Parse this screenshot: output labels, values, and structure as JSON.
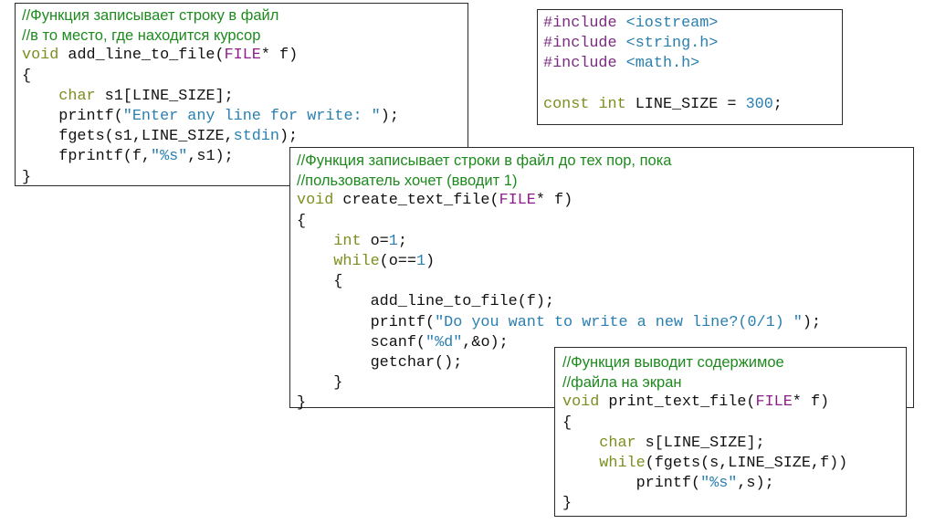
{
  "box_add_line": {
    "lines": [
      [
        {
          "t": "//Функция записывает строку в файл",
          "c": "comment"
        }
      ],
      [
        {
          "t": "//в то место, где находится курсор",
          "c": "comment"
        }
      ],
      [
        {
          "t": "void",
          "c": "kw"
        },
        {
          "t": " add_line_to_file(",
          "c": "plain"
        },
        {
          "t": "FILE",
          "c": "type"
        },
        {
          "t": "* f)",
          "c": "plain"
        }
      ],
      [
        {
          "t": "{",
          "c": "plain"
        }
      ],
      [
        {
          "t": "    ",
          "c": "plain"
        },
        {
          "t": "char",
          "c": "kw"
        },
        {
          "t": " s1[LINE_SIZE];",
          "c": "plain"
        }
      ],
      [
        {
          "t": "    printf(",
          "c": "plain"
        },
        {
          "t": "\"Enter any line for write: \"",
          "c": "str"
        },
        {
          "t": ");",
          "c": "plain"
        }
      ],
      [
        {
          "t": "    fgets(s1,LINE_SIZE,",
          "c": "plain"
        },
        {
          "t": "stdin",
          "c": "str"
        },
        {
          "t": ");",
          "c": "plain"
        }
      ],
      [
        {
          "t": "    fprintf(f,",
          "c": "plain"
        },
        {
          "t": "\"%s\"",
          "c": "str"
        },
        {
          "t": ",s1);",
          "c": "plain"
        }
      ],
      [
        {
          "t": "}",
          "c": "plain"
        }
      ]
    ]
  },
  "box_includes": {
    "lines": [
      [
        {
          "t": "#include",
          "c": "inc"
        },
        {
          "t": " ",
          "c": "plain"
        },
        {
          "t": "<iostream>",
          "c": "hdr"
        }
      ],
      [
        {
          "t": "#include",
          "c": "inc"
        },
        {
          "t": " ",
          "c": "plain"
        },
        {
          "t": "<string.h>",
          "c": "hdr"
        }
      ],
      [
        {
          "t": "#include",
          "c": "inc"
        },
        {
          "t": " ",
          "c": "plain"
        },
        {
          "t": "<math.h>",
          "c": "hdr"
        }
      ],
      [
        {
          "t": "",
          "c": "plain"
        }
      ],
      [
        {
          "t": "const",
          "c": "kw"
        },
        {
          "t": " ",
          "c": "plain"
        },
        {
          "t": "int",
          "c": "kw"
        },
        {
          "t": " LINE_SIZE = ",
          "c": "plain"
        },
        {
          "t": "300",
          "c": "num"
        },
        {
          "t": ";",
          "c": "plain"
        }
      ]
    ]
  },
  "box_create": {
    "lines": [
      [
        {
          "t": "//Функция записывает строки в файл до тех пор, пока",
          "c": "comment"
        }
      ],
      [
        {
          "t": "//пользователь хочет (вводит 1)",
          "c": "comment"
        }
      ],
      [
        {
          "t": "void",
          "c": "kw"
        },
        {
          "t": " create_text_file(",
          "c": "plain"
        },
        {
          "t": "FILE",
          "c": "type"
        },
        {
          "t": "* f)",
          "c": "plain"
        }
      ],
      [
        {
          "t": "{",
          "c": "plain"
        }
      ],
      [
        {
          "t": "    ",
          "c": "plain"
        },
        {
          "t": "int",
          "c": "kw"
        },
        {
          "t": " o=",
          "c": "plain"
        },
        {
          "t": "1",
          "c": "num"
        },
        {
          "t": ";",
          "c": "plain"
        }
      ],
      [
        {
          "t": "    ",
          "c": "plain"
        },
        {
          "t": "while",
          "c": "kw"
        },
        {
          "t": "(o==",
          "c": "plain"
        },
        {
          "t": "1",
          "c": "num"
        },
        {
          "t": ")",
          "c": "plain"
        }
      ],
      [
        {
          "t": "    {",
          "c": "plain"
        }
      ],
      [
        {
          "t": "        add_line_to_file(f);",
          "c": "plain"
        }
      ],
      [
        {
          "t": "        printf(",
          "c": "plain"
        },
        {
          "t": "\"Do you want to write a new line?(0/1) \"",
          "c": "str"
        },
        {
          "t": ");",
          "c": "plain"
        }
      ],
      [
        {
          "t": "        scanf(",
          "c": "plain"
        },
        {
          "t": "\"%d\"",
          "c": "str"
        },
        {
          "t": ",&o);",
          "c": "plain"
        }
      ],
      [
        {
          "t": "        getchar();",
          "c": "plain"
        }
      ],
      [
        {
          "t": "    }",
          "c": "plain"
        }
      ],
      [
        {
          "t": "}",
          "c": "plain"
        }
      ]
    ]
  },
  "box_print": {
    "lines": [
      [
        {
          "t": "//Функция выводит содержимое",
          "c": "comment"
        }
      ],
      [
        {
          "t": "//файла на экран",
          "c": "comment"
        }
      ],
      [
        {
          "t": "void",
          "c": "kw"
        },
        {
          "t": " print_text_file(",
          "c": "plain"
        },
        {
          "t": "FILE",
          "c": "type"
        },
        {
          "t": "* f)",
          "c": "plain"
        }
      ],
      [
        {
          "t": "{",
          "c": "plain"
        }
      ],
      [
        {
          "t": "    ",
          "c": "plain"
        },
        {
          "t": "char",
          "c": "kw"
        },
        {
          "t": " s[LINE_SIZE];",
          "c": "plain"
        }
      ],
      [
        {
          "t": "    ",
          "c": "plain"
        },
        {
          "t": "while",
          "c": "kw"
        },
        {
          "t": "(fgets(s,LINE_SIZE,f))",
          "c": "plain"
        }
      ],
      [
        {
          "t": "        printf(",
          "c": "plain"
        },
        {
          "t": "\"%s\"",
          "c": "str"
        },
        {
          "t": ",s);",
          "c": "plain"
        }
      ],
      [
        {
          "t": "}",
          "c": "plain"
        }
      ]
    ]
  },
  "colors": {
    "comment": "#1e8a1e",
    "keyword": "#7a8f1e",
    "type": "#8b1e8b",
    "string": "#2a7fb0",
    "include": "#7a2a7f",
    "plain": "#111111",
    "border": "#2a2a2a"
  }
}
